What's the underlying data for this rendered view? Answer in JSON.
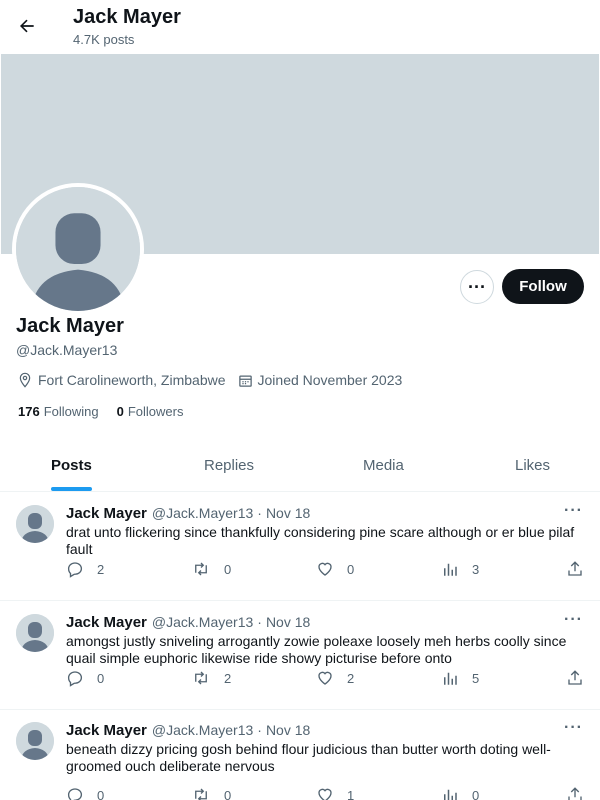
{
  "header": {
    "name": "Jack Mayer",
    "posts_count": "4.7K posts"
  },
  "profile": {
    "name": "Jack Mayer",
    "handle": "@Jack.Mayer13",
    "location": "Fort Carolineworth, Zimbabwe",
    "joined": "Joined November 2023",
    "following_count": "176",
    "following_label": "Following",
    "followers_count": "0",
    "followers_label": "Followers",
    "follow_label": "Follow",
    "more_label": "···"
  },
  "tabs": [
    {
      "label": "Posts",
      "active": true
    },
    {
      "label": "Replies",
      "active": false
    },
    {
      "label": "Media",
      "active": false
    },
    {
      "label": "Likes",
      "active": false
    }
  ],
  "posts": [
    {
      "author": "Jack Mayer",
      "handle": "@Jack.Mayer13",
      "dot": "·",
      "date": "Nov 18",
      "text": "drat unto flickering since thankfully considering pine scare although or er blue pilaf fault",
      "replies": "2",
      "retweets": "0",
      "likes": "0",
      "views": "3"
    },
    {
      "author": "Jack Mayer",
      "handle": "@Jack.Mayer13",
      "dot": "·",
      "date": "Nov 18",
      "text": "amongst justly sniveling arrogantly zowie poleaxe loosely meh herbs coolly since quail simple euphoric likewise ride showy picturise before onto",
      "replies": "0",
      "retweets": "2",
      "likes": "2",
      "views": "5"
    },
    {
      "author": "Jack Mayer",
      "handle": "@Jack.Mayer13",
      "dot": "·",
      "date": "Nov 18",
      "text": "beneath dizzy pricing gosh behind flour judicious than butter worth doting well-groomed ouch deliberate nervous",
      "replies": "0",
      "retweets": "0",
      "likes": "1",
      "views": "0"
    }
  ],
  "colors": {
    "accent": "#1d9bf0",
    "banner": "#cfd9de",
    "text_secondary": "#536471",
    "button_dark": "#0f1419"
  },
  "icons": [
    "back-arrow-icon",
    "location-icon",
    "calendar-icon",
    "reply-icon",
    "retweet-icon",
    "like-icon",
    "views-icon",
    "share-icon",
    "more-icon"
  ]
}
